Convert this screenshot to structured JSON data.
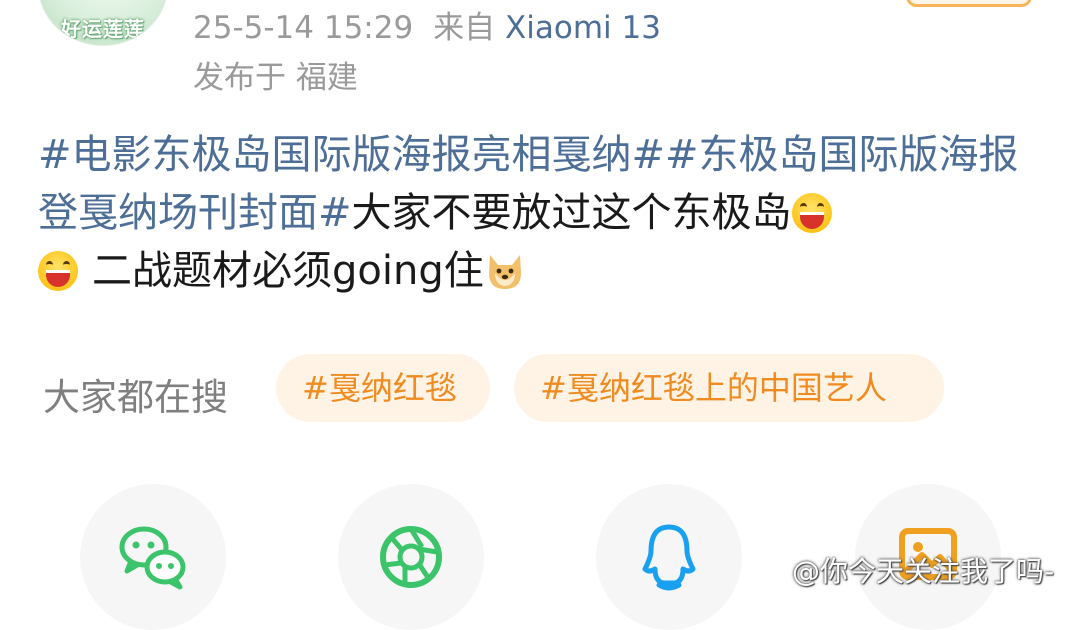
{
  "header": {
    "avatar_text": "好运莲莲",
    "timestamp": "25-5-14 15:29",
    "source_prefix": "来自",
    "device": "Xiaomi 13",
    "location": "发布于 福建"
  },
  "post": {
    "topic1": "#电影东极岛国际版海报亮相戛纳#",
    "topic2": "#东极岛国际版海报登戛纳场刊封面#",
    "text1": "大家不要放过这个东极岛",
    "text2": "二战题材必须going住",
    "emojis": [
      "laugh-emoji",
      "laugh-emoji",
      "doge-emoji"
    ]
  },
  "search": {
    "label": "大家都在搜",
    "chips": [
      "#戛纳红毯",
      "#戛纳红毯上的中国艺人"
    ]
  },
  "share": {
    "buttons": [
      "wechat-icon",
      "moments-icon",
      "qq-icon",
      "album-icon"
    ]
  },
  "watermark": {
    "text": "@你今天关注我了吗-"
  },
  "colors": {
    "topic": "#4d6e96",
    "chip_bg": "#fff3e6",
    "chip_text": "#f08b1f",
    "meta_text": "#9a9a9a",
    "wechat_green": "#3cc46b",
    "qq_blue": "#1aa0f0",
    "album_orange": "#f0a020"
  }
}
